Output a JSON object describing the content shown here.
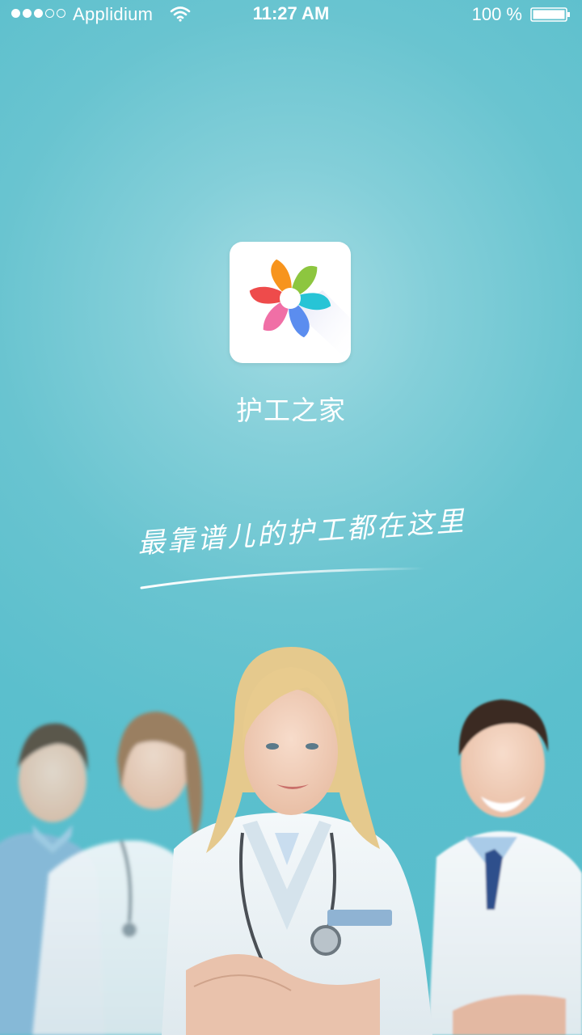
{
  "status_bar": {
    "carrier": "Applidium",
    "time": "11:27 AM",
    "battery": "100 %",
    "signal_bars_filled": 3,
    "signal_bars_total": 5,
    "wifi_icon": "wifi-icon",
    "battery_icon": "battery-full-icon"
  },
  "app": {
    "title": "护工之家",
    "tagline": "最靠谱儿的护工都在这里",
    "logo_icon": "flower-pinwheel-icon"
  },
  "colors": {
    "background": "#5bbfcd",
    "background_glow": "#a4dce3",
    "text": "#ffffff",
    "logo_petals": [
      "#f7941d",
      "#8dc63f",
      "#27c4d6",
      "#5b8def",
      "#f06fa6",
      "#ee4b4b"
    ]
  },
  "illustration": {
    "subject": "medical-team-icon"
  }
}
